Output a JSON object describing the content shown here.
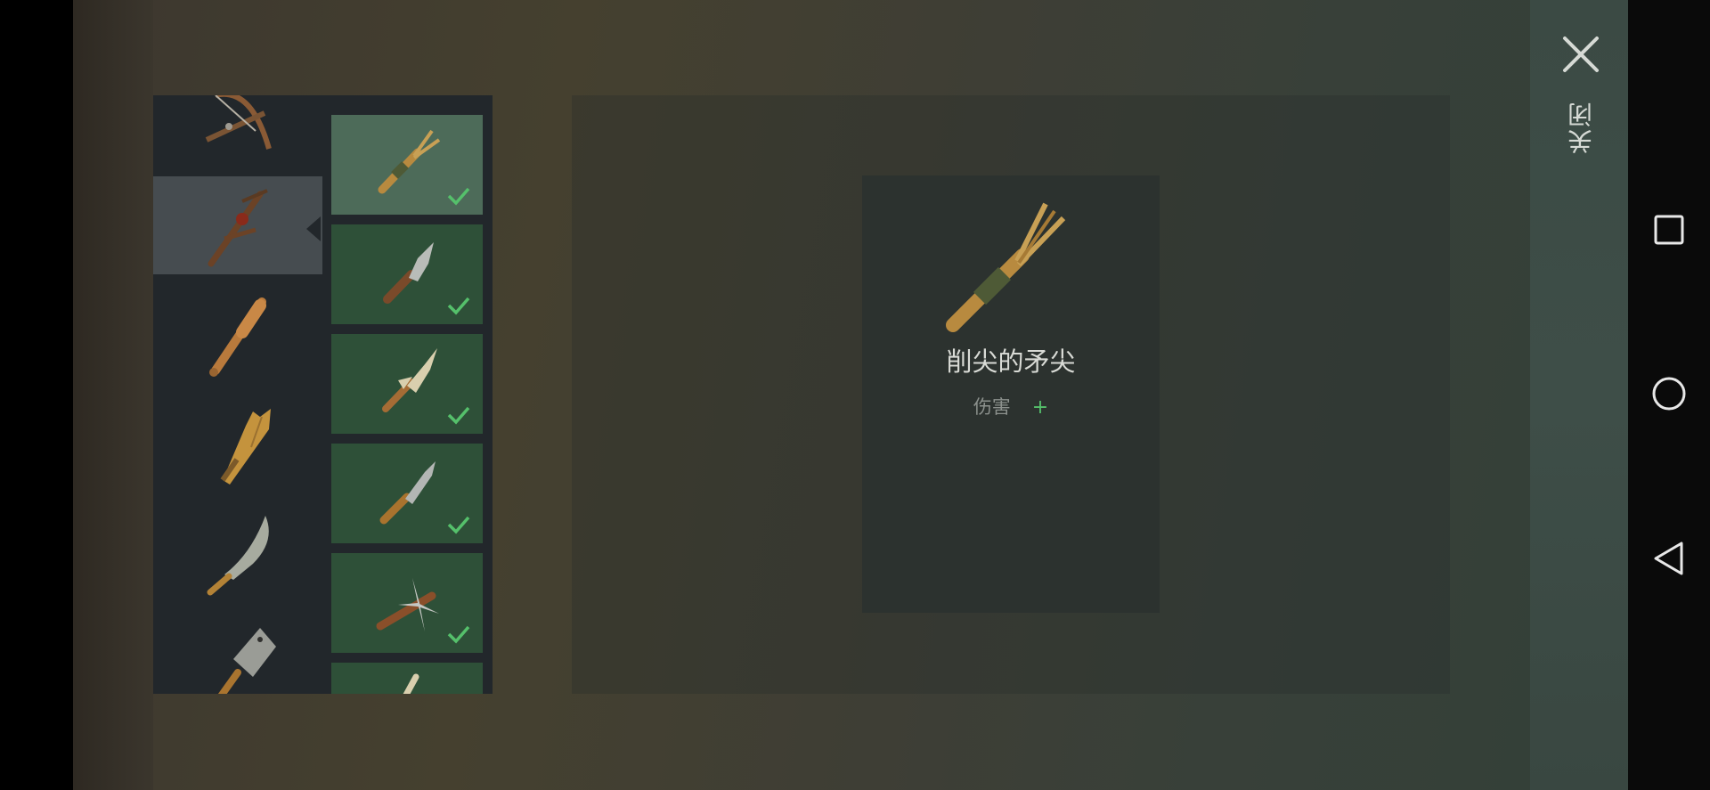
{
  "header": {
    "close_label": "关闭"
  },
  "categories": [
    {
      "name": "crossbow",
      "selected": false
    },
    {
      "name": "spear",
      "selected": true
    },
    {
      "name": "bat",
      "selected": false
    },
    {
      "name": "plank",
      "selected": false
    },
    {
      "name": "machete",
      "selected": false
    },
    {
      "name": "cleaver",
      "selected": false
    }
  ],
  "items": [
    {
      "name": "sharpened-spear-tip",
      "crafted": true,
      "selected": true
    },
    {
      "name": "stone-spear-tip",
      "crafted": true,
      "selected": false
    },
    {
      "name": "bone-spear-tip",
      "crafted": true,
      "selected": false
    },
    {
      "name": "knife-spear-tip",
      "crafted": true,
      "selected": false
    },
    {
      "name": "spiked-spear-tip",
      "crafted": true,
      "selected": false
    },
    {
      "name": "partial-item",
      "crafted": false,
      "selected": false
    }
  ],
  "detail": {
    "name": "削尖的矛尖",
    "stat_label": "伤害",
    "stat_value": "+"
  },
  "colors": {
    "accent_green": "#55c06b",
    "tile_green": "#2e5038",
    "tile_selected": "#4d6b59",
    "panel_dark": "#22272b"
  }
}
